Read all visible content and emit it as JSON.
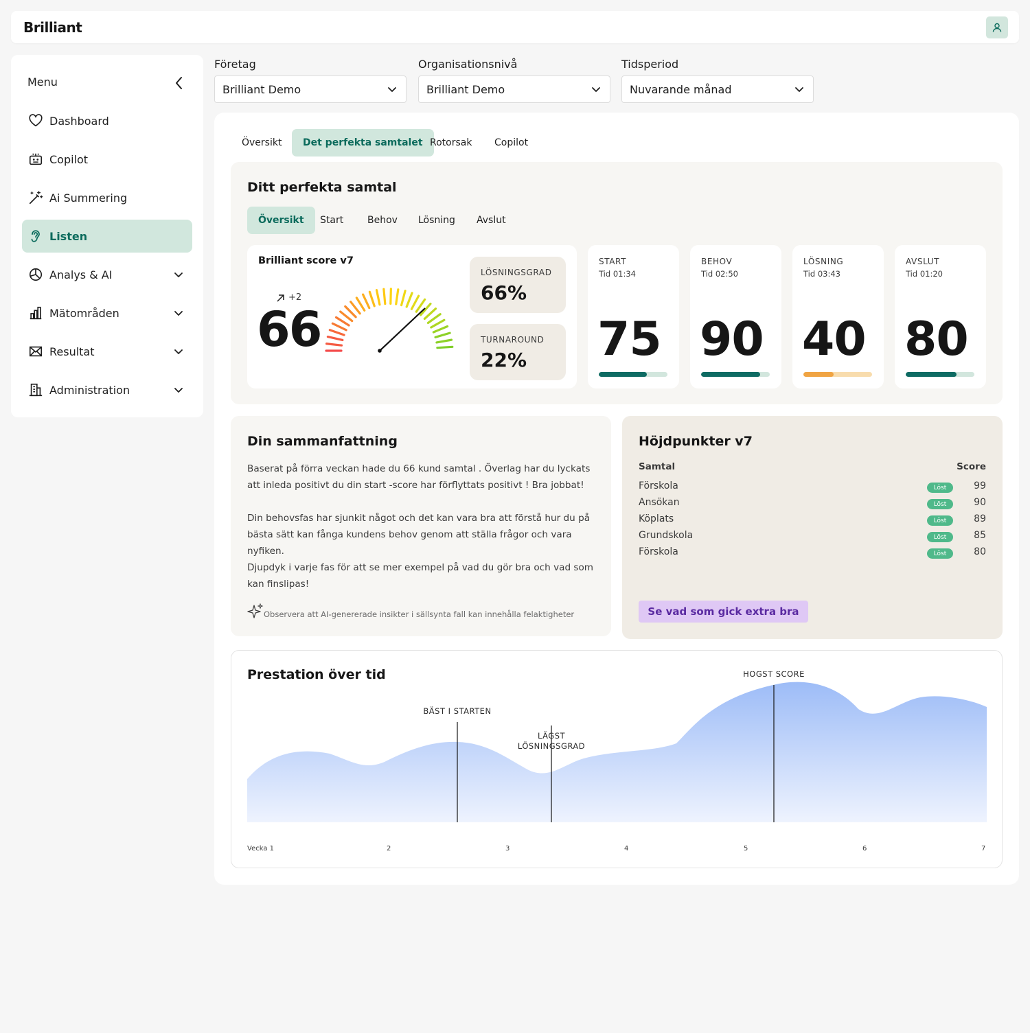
{
  "app": {
    "logo": "Brilliant"
  },
  "sidebar": {
    "menu_label": "Menu",
    "items": [
      {
        "label": "Dashboard",
        "icon": "heart-icon"
      },
      {
        "label": "Copilot",
        "icon": "robot-icon"
      },
      {
        "label": "Ai Summering",
        "icon": "magic-wand-icon"
      },
      {
        "label": "Listen",
        "icon": "ear-icon",
        "active": true
      },
      {
        "label": "Analys & AI",
        "icon": "pie-chart-icon",
        "expandable": true
      },
      {
        "label": "Mätområden",
        "icon": "bar-chart-icon",
        "expandable": true
      },
      {
        "label": "Resultat",
        "icon": "mail-icon",
        "expandable": true
      },
      {
        "label": "Administration",
        "icon": "building-icon",
        "expandable": true
      }
    ]
  },
  "filters": {
    "company": {
      "label": "Företag",
      "value": "Brilliant Demo"
    },
    "org_level": {
      "label": "Organisationsnivå",
      "value": "Brilliant Demo"
    },
    "period": {
      "label": "Tidsperiod",
      "value": "Nuvarande månad"
    }
  },
  "tabs": [
    "Översikt",
    "Det perfekta samtalet",
    "Rotorsak",
    "Copilot"
  ],
  "active_tab": "Det perfekta samtalet",
  "perfect": {
    "title": "Ditt perfekta samtal",
    "subtabs": [
      "Översikt",
      "Start",
      "Behov",
      "Lösning",
      "Avslut"
    ],
    "active_subtab": "Översikt",
    "score": {
      "title": "Brilliant score v7",
      "delta": "+2",
      "value": "66",
      "gauge_level": 0.66
    },
    "solution_rate": {
      "label": "LÖSNINGSGRAD",
      "value": "66%"
    },
    "turnaround": {
      "label": "TURNAROUND",
      "value": "22%"
    },
    "phases": [
      {
        "name": "START",
        "time": "Tid 01:34",
        "score": "75",
        "level": 0.7,
        "color": "#0e6b63",
        "track": "#d2e6dd"
      },
      {
        "name": "BEHOV",
        "time": "Tid 02:50",
        "score": "90",
        "level": 0.86,
        "color": "#0e6b63",
        "track": "#d2e6dd"
      },
      {
        "name": "LÖSNING",
        "time": "Tid 03:43",
        "score": "40",
        "level": 0.44,
        "color": "#f0a443",
        "track": "#f8dcad"
      },
      {
        "name": "AVSLUT",
        "time": "Tid 01:20",
        "score": "80",
        "level": 0.74,
        "color": "#0e6b63",
        "track": "#d2e6dd"
      }
    ]
  },
  "summary": {
    "title": "Din sammanfattning",
    "p1": "Baserat på förra veckan hade du 66 kund samtal . Överlag har du lyckats att inleda positivt du din start -score har förflyttats positivt ! Bra jobbat!",
    "p2": "Din behovsfas har sjunkit något och det kan vara bra att förstå hur du på bästa sätt kan fånga kundens behov genom att ställa frågor och vara nyfiken.",
    "p3": "Djupdyk i varje fas för att se mer exempel på vad du gör bra och vad som kan finslipas!",
    "disclaimer": "Observera att AI-genererade insikter i sällsynta fall kan innehålla felaktigheter"
  },
  "highlights": {
    "title": "Höjdpunkter v7",
    "col_call": "Samtal",
    "col_score": "Score",
    "rows": [
      {
        "name": "Förskola",
        "badge": "Löst",
        "score": "99"
      },
      {
        "name": "Ansökan",
        "badge": "Löst",
        "score": "90"
      },
      {
        "name": "Köplats",
        "badge": "Löst",
        "score": "89"
      },
      {
        "name": "Grundskola",
        "badge": "Löst",
        "score": "85"
      },
      {
        "name": "Förskola",
        "badge": "Löst",
        "score": "80"
      }
    ],
    "cta": "Se vad som gick extra bra"
  },
  "performance": {
    "title": "Prestation över tid",
    "annotations": [
      "BÄST I STARTEN",
      "LÄGST LÖSNINGSGRAD",
      "HÖGST SCORE"
    ],
    "annotation_weeks": [
      2.77,
      3.37,
      5.24
    ],
    "x_labels": [
      "Vecka 1",
      "2",
      "3",
      "4",
      "5",
      "6",
      "7"
    ],
    "fill_color": "#9dbcf7"
  }
}
